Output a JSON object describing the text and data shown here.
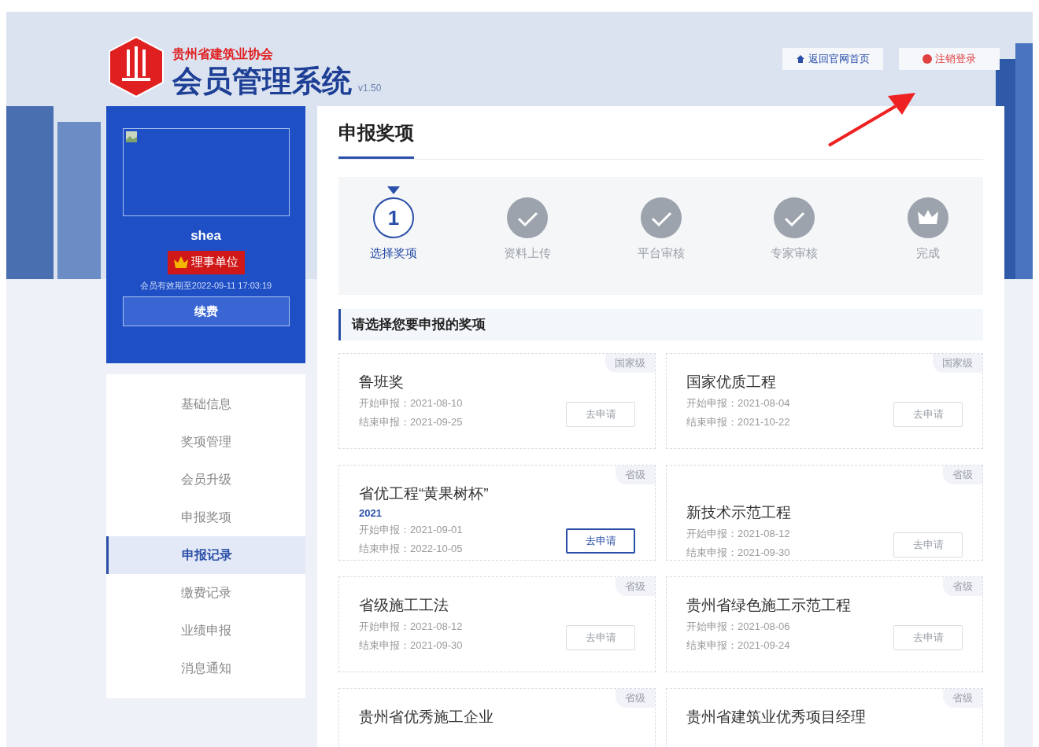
{
  "header": {
    "org_name": "贵州省建筑业协会",
    "system_title": "会员管理系统",
    "version": "v1.50",
    "buttons": [
      {
        "kind": "home",
        "label": "返回官网首页"
      },
      {
        "kind": "logout",
        "label": "注销登录"
      }
    ]
  },
  "profile": {
    "username": "shea",
    "member_badge": "理事单位",
    "expiry": "会员有效期至2022-09-11 17:03:19",
    "renew_button": "续费"
  },
  "sidebar": {
    "items": [
      {
        "label": "基础信息",
        "selected": false
      },
      {
        "label": "奖项管理",
        "selected": false
      },
      {
        "label": "会员升级",
        "selected": false
      },
      {
        "label": "申报奖项",
        "selected": false
      },
      {
        "label": "申报记录",
        "selected": true
      },
      {
        "label": "缴费记录",
        "selected": false
      },
      {
        "label": "业绩申报",
        "selected": false
      },
      {
        "label": "消息通知",
        "selected": false
      }
    ]
  },
  "content": {
    "title": "申报奖项",
    "steps": [
      {
        "kind": "number",
        "number": "1",
        "label": "选择奖项",
        "selected": true
      },
      {
        "kind": "check",
        "label": "资料上传",
        "selected": false
      },
      {
        "kind": "check",
        "label": "平台审核",
        "selected": false
      },
      {
        "kind": "check",
        "label": "专家审核",
        "selected": false
      },
      {
        "kind": "crown",
        "label": "完成",
        "selected": false
      }
    ],
    "section_title": "请选择您要申报的奖项",
    "awards": [
      {
        "level": "国家级",
        "title": "鲁班奖",
        "start": "开始申报：2021-08-10",
        "end": "结束申报：2021-09-25",
        "button": "去申请",
        "enabled": false
      },
      {
        "level": "国家级",
        "title": "国家优质工程",
        "start": "开始申报：2021-08-04",
        "end": "结束申报：2021-10-22",
        "button": "去申请",
        "enabled": false
      },
      {
        "level": "省级",
        "title": "省优工程“黄果树杯”",
        "year": "2021",
        "start": "开始申报：2021-09-01",
        "end": "结束申报：2022-10-05",
        "button": "去申请",
        "enabled": true
      },
      {
        "level": "省级",
        "title": "新技术示范工程",
        "start": "开始申报：2021-08-12",
        "end": "结束申报：2021-09-30",
        "button": "去申请",
        "enabled": false
      },
      {
        "level": "省级",
        "title": "省级施工工法",
        "start": "开始申报：2021-08-12",
        "end": "结束申报：2021-09-30",
        "button": "去申请",
        "enabled": false
      },
      {
        "level": "省级",
        "title": "贵州省绿色施工示范工程",
        "start": "开始申报：2021-08-06",
        "end": "结束申报：2021-09-24",
        "button": "去申请",
        "enabled": false
      },
      {
        "level": "省级",
        "title": "贵州省优秀施工企业"
      },
      {
        "level": "省级",
        "title": "贵州省建筑业优秀项目经理"
      }
    ]
  }
}
